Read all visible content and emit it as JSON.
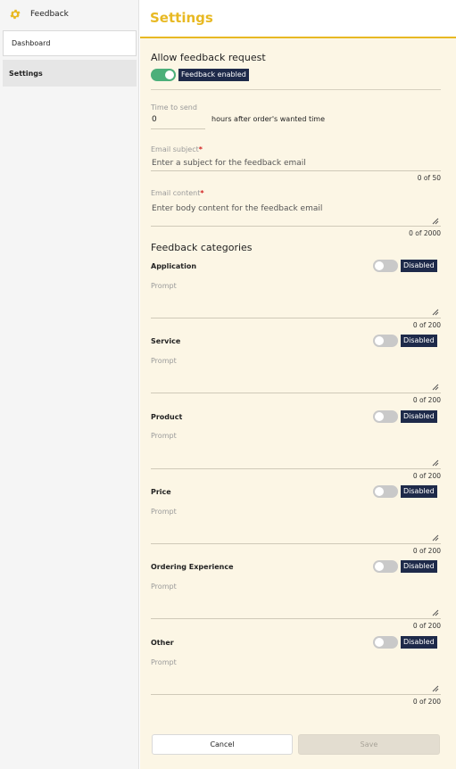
{
  "sidebar": {
    "app_title": "Feedback",
    "items": [
      {
        "label": "Dashboard"
      },
      {
        "label": "Settings"
      }
    ]
  },
  "header": {
    "title": "Settings"
  },
  "allow_feedback": {
    "heading": "Allow feedback request",
    "toggle_state": "on",
    "badge": "Feedback enabled"
  },
  "time_to_send": {
    "label": "Time to send",
    "value": "0",
    "suffix": "hours after order's wanted time"
  },
  "email_subject": {
    "label": "Email subject",
    "required_mark": "*",
    "placeholder": "Enter a subject for the feedback email",
    "counter": "0 of 50"
  },
  "email_content": {
    "label": "Email content",
    "required_mark": "*",
    "placeholder": "Enter body content for the feedback email",
    "counter": "0 of 2000"
  },
  "categories_heading": "Feedback categories",
  "categories": [
    {
      "name": "Application",
      "status": "Disabled",
      "prompt_label": "Prompt",
      "counter": "0 of 200"
    },
    {
      "name": "Service",
      "status": "Disabled",
      "prompt_label": "Prompt",
      "counter": "0 of 200"
    },
    {
      "name": "Product",
      "status": "Disabled",
      "prompt_label": "Prompt",
      "counter": "0 of 200"
    },
    {
      "name": "Price",
      "status": "Disabled",
      "prompt_label": "Prompt",
      "counter": "0 of 200"
    },
    {
      "name": "Ordering Experience",
      "status": "Disabled",
      "prompt_label": "Prompt",
      "counter": "0 of 200"
    },
    {
      "name": "Other",
      "status": "Disabled",
      "prompt_label": "Prompt",
      "counter": "0 of 200"
    }
  ],
  "actions": {
    "cancel_label": "Cancel",
    "save_label": "Save"
  },
  "colors": {
    "accent": "#e8b923",
    "toggle_on": "#4caf7a",
    "badge_bg": "#1e2a4a",
    "content_bg": "#fcf6e5"
  }
}
